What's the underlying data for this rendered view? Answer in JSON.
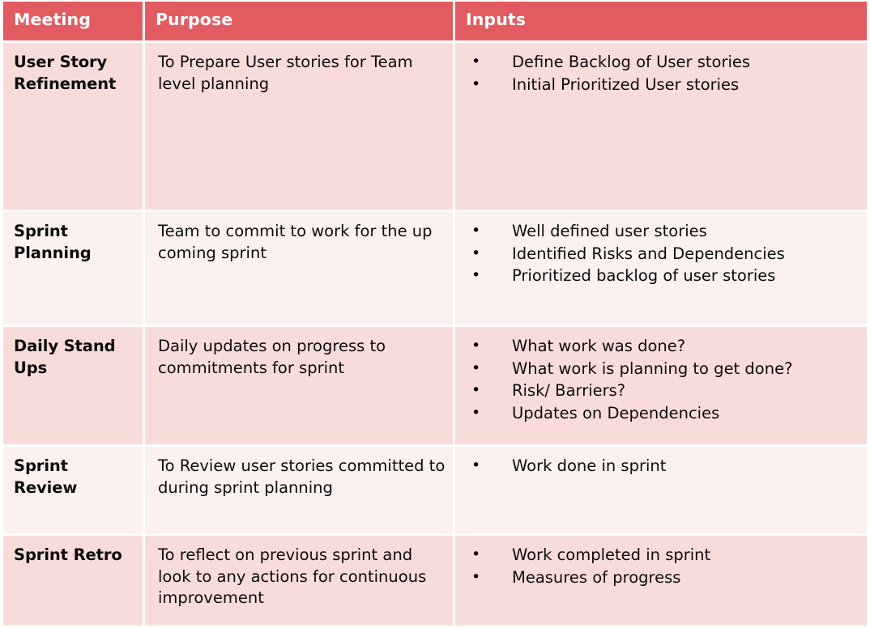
{
  "table": {
    "columns": [
      {
        "key": "meeting",
        "label": "Meeting"
      },
      {
        "key": "purpose",
        "label": "Purpose"
      },
      {
        "key": "inputs",
        "label": "Inputs"
      }
    ],
    "bullet_glyph": "•",
    "colors": {
      "header_background": "#E15B60",
      "header_text": "#FFFFFF",
      "row_shade_dark": "#F7DCD9",
      "row_shade_light": "#FCF1EF",
      "body_text": "#0C0C0C",
      "page_background": "#FFFFFF"
    },
    "rows": [
      {
        "meeting": "User Story Refinement",
        "purpose": "To Prepare User stories for Team level planning",
        "inputs": [
          "Define Backlog of User stories",
          "Initial Prioritized User stories"
        ]
      },
      {
        "meeting": "Sprint Planning",
        "purpose": "Team to commit to work for the up coming sprint",
        "inputs": [
          "Well defined user stories",
          "Identified Risks and Dependencies",
          "Prioritized backlog of user stories"
        ]
      },
      {
        "meeting": "Daily Stand Ups",
        "purpose": "Daily updates on progress to commitments for sprint",
        "inputs": [
          "What work was done?",
          "What work is planning to get done?",
          "Risk/ Barriers?",
          "Updates on Dependencies"
        ]
      },
      {
        "meeting": "Sprint Review",
        "purpose": "To Review user stories committed to during sprint planning",
        "inputs": [
          "Work done in sprint"
        ]
      },
      {
        "meeting": "Sprint Retro",
        "purpose": "To reflect on previous sprint and look to any actions for continuous improvement",
        "inputs": [
          "Work completed in sprint",
          "Measures of progress"
        ]
      }
    ]
  }
}
